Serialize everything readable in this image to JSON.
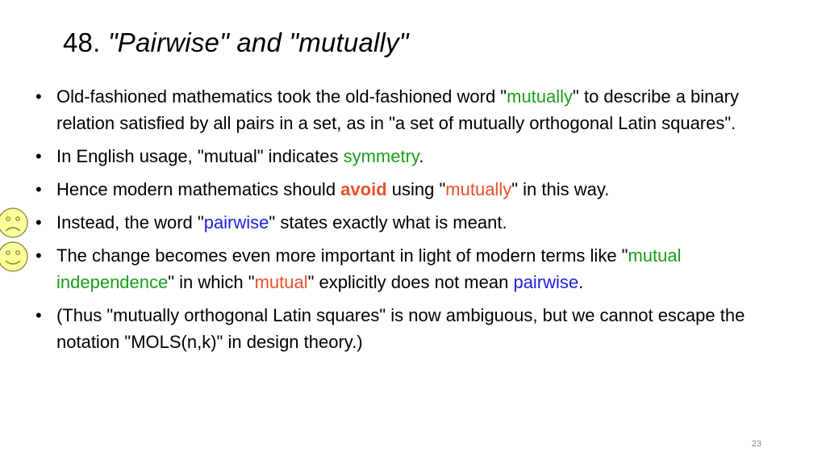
{
  "title": {
    "number": "48.",
    "text": "\"Pairwise\" and \"mutually\""
  },
  "bullets": [
    {
      "b": "•",
      "p1": "Old-fashioned mathematics took the old-fashioned word \"",
      "h1": "mutually",
      "p2": "\" to describe a binary relation satisfied by all pairs in a set, as in \"a set of mutually orthogonal Latin squares\"."
    },
    {
      "b": "•",
      "p1": "In English usage, \"mutual\" indicates ",
      "h1": "symmetry",
      "p2": "."
    },
    {
      "b": "•",
      "p1": "Hence modern mathematics should ",
      "h1": "avoid",
      "p2": " using \"",
      "h2": "mutually",
      "p3": "\" in this way."
    },
    {
      "b": "•",
      "p1": "Instead, the word \"",
      "h1": "pairwise",
      "p2": "\" states exactly what is meant."
    },
    {
      "b": "•",
      "p1": "The change becomes even more important in light of modern terms like \"",
      "h1": "mutual independence",
      "p2": "\" in which \"",
      "h2": "mutual",
      "p3": "\" explicitly does not mean ",
      "h3": "pairwise",
      "p4": "."
    },
    {
      "b": "•",
      "p1": "(Thus \"mutually orthogonal Latin squares\" is now ambiguous, but we cannot escape the notation \"MOLS(n,k)\" in design theory.)"
    }
  ],
  "icons": {
    "frown": "frowning-face-icon",
    "smile": "smiling-face-icon",
    "face_fill": "#ffff99",
    "face_stroke": "#7f7f3f"
  },
  "colors": {
    "green": "#1a9e1a",
    "red": "#e8502a",
    "blue": "#1f1fe0"
  },
  "page_number": "23"
}
